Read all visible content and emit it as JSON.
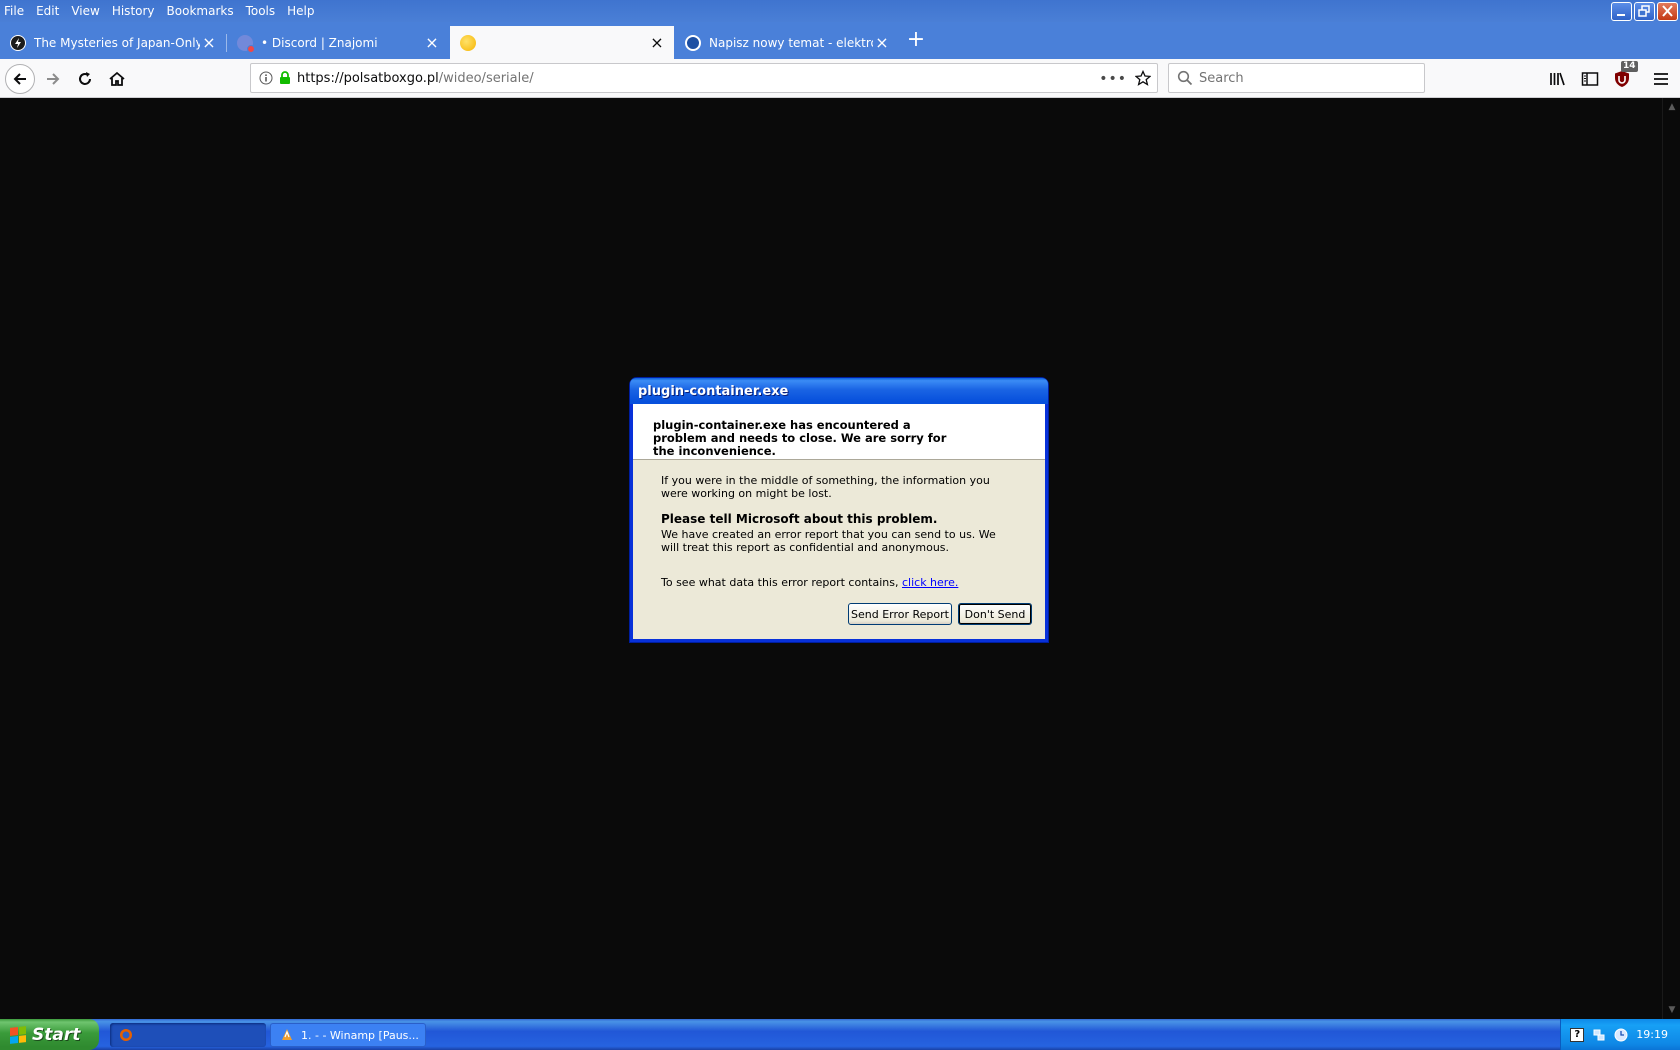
{
  "menubar": {
    "items": [
      "File",
      "Edit",
      "View",
      "History",
      "Bookmarks",
      "Tools",
      "Help"
    ]
  },
  "tabs": [
    {
      "title": "The Mysteries of Japan-Only Phon",
      "favicon": "bolt-circle-favicon",
      "color": "#1c1c1c"
    },
    {
      "title": "• Discord | Znajomi",
      "favicon": "discord-favicon",
      "color": "#7289da"
    },
    {
      "title": "",
      "favicon": "polsat-sun-favicon",
      "color": "#f6c31c"
    },
    {
      "title": "Napisz nowy temat - elektroda.pl",
      "favicon": "elektroda-favicon",
      "color": "#1d4fa3"
    }
  ],
  "urlbar": {
    "host": "https://polsatboxgo.pl",
    "path": "/wideo/seriale/"
  },
  "search": {
    "placeholder": "Search"
  },
  "ublock": {
    "count": "14"
  },
  "dialog": {
    "title": "plugin-container.exe",
    "header": "plugin-container.exe has encountered a problem and needs to close.  We are sorry for the inconvenience.",
    "info": "If you were in the middle of something, the information you were working on might be lost.",
    "tell_heading": "Please tell Microsoft about this problem.",
    "report_text": "We have created an error report that you can send to us.  We will treat this report as confidential and anonymous.",
    "data_prefix": "To see what data this error report contains, ",
    "data_link": "click here.",
    "send_button": "Send Error Report",
    "dont_send_button": "Don't Send"
  },
  "taskbar": {
    "start_label": "Start",
    "tasks": [
      {
        "label": "",
        "icon": "firefox-icon",
        "active": true
      },
      {
        "label": "1.  -  - Winamp [Paus...",
        "icon": "winamp-icon",
        "active": false
      }
    ],
    "clock": "19:19"
  },
  "colors": {
    "titlebar_blue": "#4a80d9",
    "dialog_blue": "#0831d9",
    "dialog_face": "#ece9d8",
    "taskbar_blue": "#2157d7",
    "start_green": "#3a9b3a",
    "content_bg": "#0a0a0a"
  }
}
